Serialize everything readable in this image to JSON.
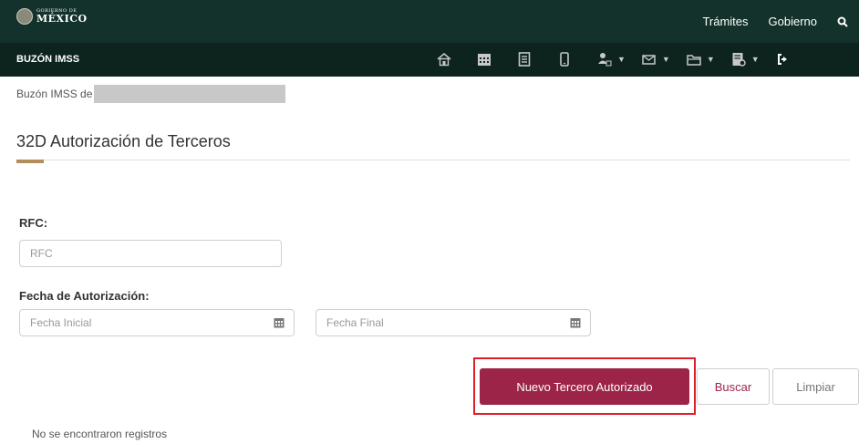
{
  "header": {
    "gov_small": "GOBIERNO DE",
    "gov_big": "MÉXICO",
    "links": [
      "Trámites",
      "Gobierno"
    ],
    "search_icon": "search-icon",
    "accent_color": "#13322b"
  },
  "navbar": {
    "title": "BUZÓN IMSS",
    "icons": [
      "home-icon",
      "calendar-icon",
      "document-icon",
      "mobile-icon",
      "users-icon",
      "envelope-icon",
      "folder-icon",
      "report-icon",
      "logout-icon"
    ]
  },
  "content": {
    "buzon_prefix": "Buzón IMSS de",
    "page_title": "32D Autorización de Terceros",
    "rfc_label": "RFC:",
    "rfc_placeholder": "RFC",
    "fecha_label": "Fecha de Autorización:",
    "fecha_inicial_placeholder": "Fecha Inicial",
    "fecha_final_placeholder": "Fecha Final",
    "buttons": {
      "nuevo": "Nuevo Tercero Autorizado",
      "buscar": "Buscar",
      "limpiar": "Limpiar"
    },
    "no_records": "No se encontraron registros"
  },
  "colors": {
    "primary": "#9d2449",
    "gold": "#b38e5d",
    "highlight": "#e01e2a"
  }
}
